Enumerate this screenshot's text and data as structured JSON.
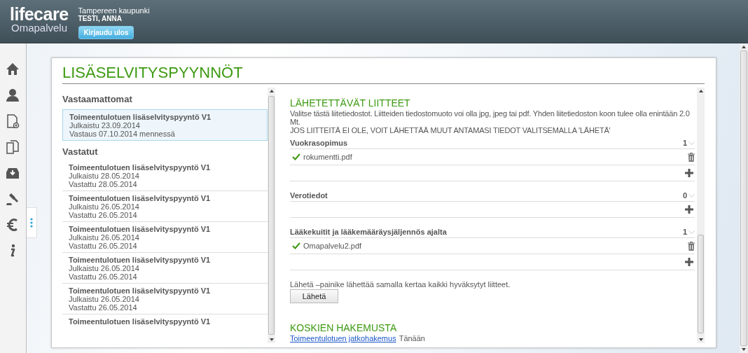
{
  "header": {
    "logo": "lifecare",
    "logo_sub": "Omapalvelu",
    "organization": "Tampereen kaupunki",
    "user": "TESTI, ANNA",
    "logout_button": "Kirjaudu ulos"
  },
  "nav": [
    {
      "kind": "home",
      "selected": false
    },
    {
      "kind": "person",
      "selected": false
    },
    {
      "kind": "new-document",
      "selected": false
    },
    {
      "kind": "documents",
      "selected": false
    },
    {
      "kind": "inbox",
      "selected": false
    },
    {
      "kind": "gavel",
      "selected": false
    },
    {
      "kind": "euro",
      "selected": true
    },
    {
      "kind": "info",
      "selected": false
    }
  ],
  "page_title": "LISÄSELVITYSPYYNNÖT",
  "requests": [
    {
      "heading": "Vastaamattomat",
      "items": [
        {
          "title": "Toimeentulotuen lisäselvityspyyntö V1",
          "lines": [
            "Julkaistu 23.09.2014",
            "Vastaus 07.10.2014 mennessä"
          ],
          "selected": true
        }
      ]
    },
    {
      "heading": "Vastatut",
      "items": [
        {
          "title": "Toimeentulotuen lisäselvityspyyntö V1",
          "lines": [
            "Julkaistu 28.05.2014",
            "Vastattu 28.05.2014"
          ],
          "selected": false
        },
        {
          "title": "Toimeentulotuen lisäselvityspyyntö V1",
          "lines": [
            "Julkaistu 26.05.2014",
            "Vastattu 26.05.2014"
          ],
          "selected": false
        },
        {
          "title": "Toimeentulotuen lisäselvityspyyntö V1",
          "lines": [
            "Julkaistu 26.05.2014",
            "Vastattu 26.05.2014"
          ],
          "selected": false
        },
        {
          "title": "Toimeentulotuen lisäselvityspyyntö V1",
          "lines": [
            "Julkaistu 26.05.2014",
            "Vastattu 26.05.2014"
          ],
          "selected": false
        },
        {
          "title": "Toimeentulotuen lisäselvityspyyntö V1",
          "lines": [
            "Julkaistu 26.05.2014",
            "Vastattu 26.05.2014"
          ],
          "selected": false
        },
        {
          "title": "Toimeentulotuen lisäselvityspyyntö V1",
          "selected": false
        }
      ]
    }
  ],
  "attachments": {
    "heading": "LÄHETETTÄVÄT LIITTEET",
    "instructions": "Valitse tästä liitetiedostot. Liitteiden tiedostomuoto voi olla jpg, jpeg tai pdf. Yhden liitetiedoston koon tulee olla enintään 2.0 Mt.",
    "notice": "JOS LIITTEITÄ EI OLE, VOIT LÄHETTÄÄ MUUT ANTAMASI TIEDOT VALITSEMALLA 'LÄHETÄ'",
    "groups": [
      {
        "name": "Vuokrasopimus",
        "count": "1",
        "files": [
          {
            "name": "rokumentti.pdf",
            "accepted": true
          }
        ]
      },
      {
        "name": "Verotiedot",
        "count": "0"
      },
      {
        "name": "Lääkekuitit ja lääkemääräysjäljennös ajalta",
        "count": "1",
        "files": [
          {
            "name": "Omapalvelu2.pdf",
            "accepted": true
          }
        ]
      }
    ],
    "send_note": "Lähetä –painike lähettää samalla kertaa kaikki hyväksytyt liitteet.",
    "send_button": "Lähetä"
  },
  "related": {
    "heading": "KOSKIEN HAKEMUSTA",
    "link": "Toimeentulotuen jatkohakemus",
    "date": "Tänään"
  }
}
